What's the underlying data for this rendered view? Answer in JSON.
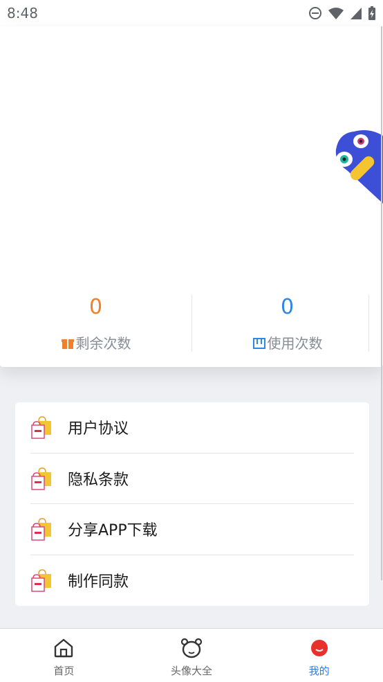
{
  "status_bar": {
    "time": "8:48",
    "icons": [
      "do-not-disturb-icon",
      "wifi-icon",
      "signal-icon",
      "battery-charging-icon"
    ]
  },
  "header": {
    "mascot_icon": "blue-mascot-icon"
  },
  "stats": [
    {
      "value": "0",
      "label": "剩余次数",
      "icon": "gift-box-icon",
      "color": "#f0802a"
    },
    {
      "value": "0",
      "label": "使用次数",
      "icon": "usage-box-icon",
      "color": "#2e86e6"
    }
  ],
  "menu": {
    "items": [
      {
        "label": "用户协议",
        "icon": "shopping-bag-icon"
      },
      {
        "label": "隐私条款",
        "icon": "shopping-bag-icon"
      },
      {
        "label": "分享APP下载",
        "icon": "shopping-bag-icon"
      },
      {
        "label": "制作同款",
        "icon": "shopping-bag-icon"
      }
    ]
  },
  "tabs": [
    {
      "label": "首页",
      "icon": "home-icon",
      "active": false
    },
    {
      "label": "头像大全",
      "icon": "bear-face-icon",
      "active": false
    },
    {
      "label": "我的",
      "icon": "smile-dot-icon",
      "active": true
    }
  ],
  "colors": {
    "accent_blue": "#2f7be5",
    "orange": "#f0802a",
    "mascot_blue": "#3d4fd6",
    "mascot_yellow": "#f5c431"
  }
}
